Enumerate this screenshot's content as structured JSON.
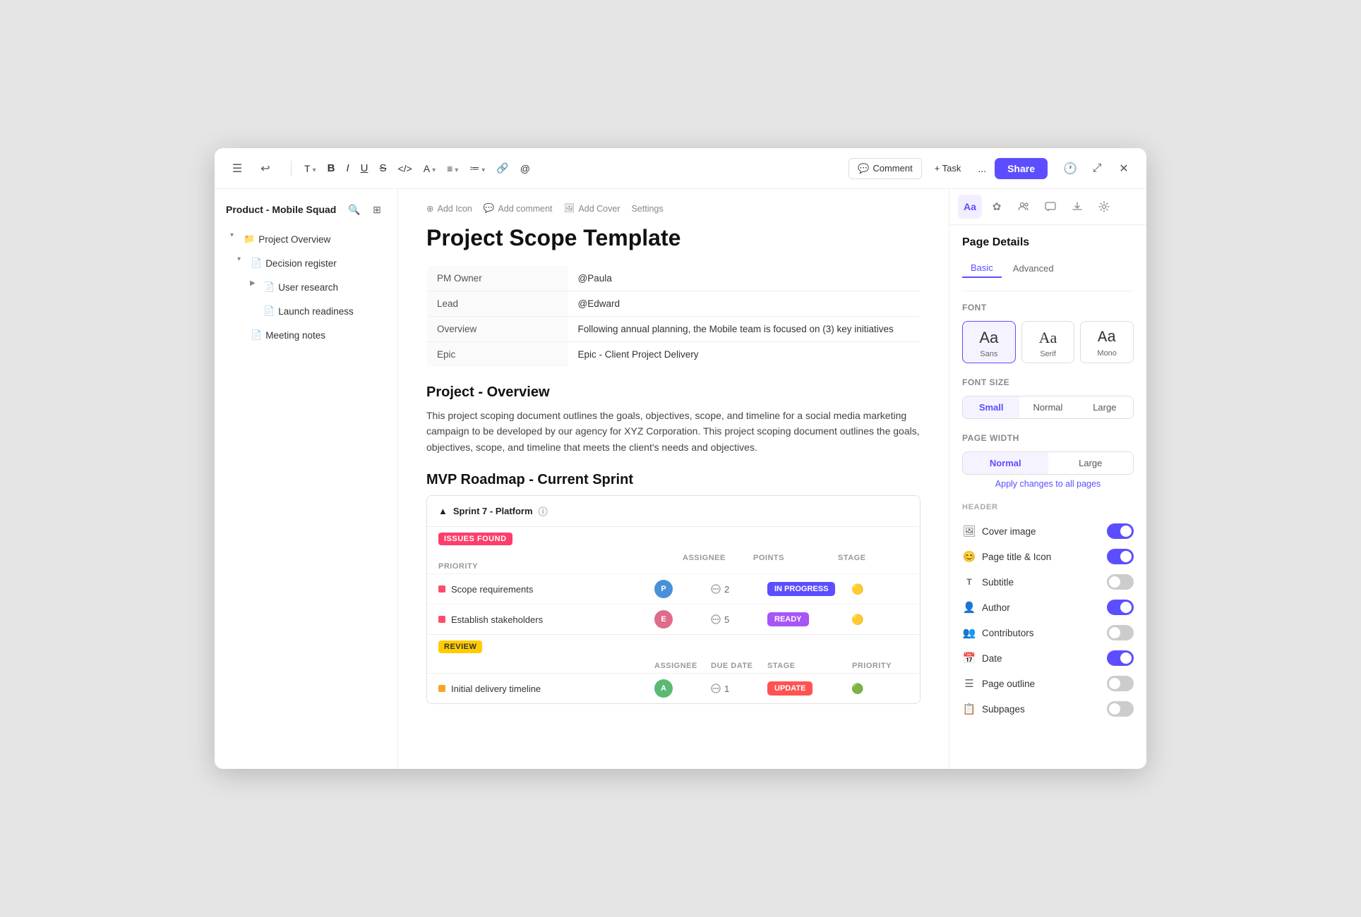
{
  "window": {
    "title": "Product - Mobile Squad"
  },
  "toolbar": {
    "hamburger": "☰",
    "back": "↩",
    "type_label": "T",
    "bold_label": "B",
    "italic_label": "I",
    "underline_label": "U",
    "strikethrough_label": "S",
    "code_label": "</>",
    "color_label": "A",
    "align_label": "≡",
    "list_label": "≔",
    "link_label": "🔗",
    "mention_label": "@",
    "comment_label": "Comment",
    "task_label": "+ Task",
    "more_label": "...",
    "share_label": "Share",
    "history_label": "🕐",
    "expand_label": "⤢",
    "close_label": "✕"
  },
  "sidebar": {
    "title": "Product - Mobile Squad",
    "search_icon": "🔍",
    "layout_icon": "⊞",
    "items": [
      {
        "id": "project-overview",
        "label": "Project Overview",
        "level": 0,
        "toggle": "▾",
        "icon": "📁",
        "active": false
      },
      {
        "id": "decision-register",
        "label": "Decision register",
        "level": 1,
        "toggle": "▾",
        "icon": "📄",
        "active": false
      },
      {
        "id": "user-research",
        "label": "User research",
        "level": 2,
        "toggle": "▶",
        "icon": "📄",
        "active": false
      },
      {
        "id": "launch-readiness",
        "label": "Launch readiness",
        "level": 2,
        "toggle": "",
        "icon": "📄",
        "active": false
      },
      {
        "id": "meeting-notes",
        "label": "Meeting notes",
        "level": 1,
        "toggle": "",
        "icon": "📄",
        "active": false
      }
    ]
  },
  "page": {
    "add_icon_label": "Add Icon",
    "add_comment_label": "Add comment",
    "add_cover_label": "Add Cover",
    "settings_label": "Settings",
    "title": "Project Scope Template",
    "info_rows": [
      {
        "key": "PM Owner",
        "value": "@Paula"
      },
      {
        "key": "Lead",
        "value": "@Edward"
      },
      {
        "key": "Overview",
        "value": "Following annual planning, the Mobile team is focused on (3) key initiatives"
      },
      {
        "key": "Epic",
        "value": "Epic - Client Project Delivery"
      }
    ],
    "section1_title": "Project - Overview",
    "section1_text": "This project scoping document outlines the goals, objectives, scope, and timeline for a social media marketing campaign to be developed by our agency for XYZ Corporation. This project scoping document outlines the goals, objectives, scope, and timeline that meets the client's needs and objectives.",
    "section2_title": "MVP Roadmap - Current Sprint",
    "sprint": {
      "name": "Sprint  7 - Platform",
      "info_icon": "ⓘ",
      "groups": [
        {
          "badge_label": "ISSUES FOUND",
          "badge_type": "issues",
          "columns": [
            "ASSIGNEE",
            "POINTS",
            "STAGE",
            "PRIORITY"
          ],
          "tasks": [
            {
              "name": "Scope requirements",
              "dot_color": "red",
              "assignee_initials": "P",
              "assignee_color": "blue",
              "points": 2,
              "stage": "IN PROGRESS",
              "stage_type": "inprogress",
              "priority": "🟡"
            },
            {
              "name": "Establish stakeholders",
              "dot_color": "red",
              "assignee_initials": "E",
              "assignee_color": "pink",
              "points": 5,
              "stage": "READY",
              "stage_type": "ready",
              "priority": "🟡"
            }
          ]
        },
        {
          "badge_label": "REVIEW",
          "badge_type": "review",
          "columns": [
            "ASSIGNEE",
            "DUE DATE",
            "STAGE",
            "PRIORITY"
          ],
          "tasks": [
            {
              "name": "Initial delivery timeline",
              "dot_color": "yellow",
              "assignee_initials": "A",
              "assignee_color": "green",
              "points": 1,
              "stage": "UPDATE",
              "stage_type": "update",
              "priority": "🟢"
            }
          ]
        }
      ]
    }
  },
  "right_panel": {
    "tabs": [
      {
        "id": "font",
        "icon": "Aa",
        "active": true
      },
      {
        "id": "emoji",
        "icon": "✿",
        "active": false
      },
      {
        "id": "users",
        "icon": "👥",
        "active": false
      },
      {
        "id": "chat",
        "icon": "💬",
        "active": false
      },
      {
        "id": "download",
        "icon": "⬇",
        "active": false
      },
      {
        "id": "settings",
        "icon": "⚙",
        "active": false
      }
    ],
    "page_details_title": "Page Details",
    "subtabs": [
      {
        "id": "basic",
        "label": "Basic",
        "active": true
      },
      {
        "id": "advanced",
        "label": "Advanced",
        "active": false
      }
    ],
    "font_section_label": "Font",
    "font_options": [
      {
        "id": "sans",
        "label": "Sans",
        "preview": "Aa",
        "active": true
      },
      {
        "id": "serif",
        "label": "Serif",
        "preview": "Aa",
        "active": false
      },
      {
        "id": "mono",
        "label": "Mono",
        "preview": "Aa",
        "active": false
      }
    ],
    "font_size_section_label": "Font Size",
    "font_sizes": [
      {
        "id": "small",
        "label": "Small",
        "active": true
      },
      {
        "id": "normal",
        "label": "Normal",
        "active": false
      },
      {
        "id": "large",
        "label": "Large",
        "active": false
      }
    ],
    "page_width_section_label": "Page Width",
    "page_widths": [
      {
        "id": "normal",
        "label": "Normal",
        "active": true
      },
      {
        "id": "large",
        "label": "Large",
        "active": false
      }
    ],
    "apply_all_label": "Apply changes to all pages",
    "header_section_label": "HEADER",
    "header_toggles": [
      {
        "id": "cover-image",
        "icon": "🖼",
        "label": "Cover image",
        "on": true
      },
      {
        "id": "page-title-icon",
        "icon": "😊",
        "label": "Page title & Icon",
        "on": true
      },
      {
        "id": "subtitle",
        "icon": "T",
        "label": "Subtitle",
        "on": false
      },
      {
        "id": "author",
        "icon": "👤",
        "label": "Author",
        "on": true
      },
      {
        "id": "contributors",
        "icon": "👥",
        "label": "Contributors",
        "on": false
      },
      {
        "id": "date",
        "icon": "📅",
        "label": "Date",
        "on": true
      },
      {
        "id": "page-outline",
        "icon": "☰",
        "label": "Page outline",
        "on": false
      },
      {
        "id": "subpages",
        "icon": "📋",
        "label": "Subpages",
        "on": false
      }
    ]
  }
}
